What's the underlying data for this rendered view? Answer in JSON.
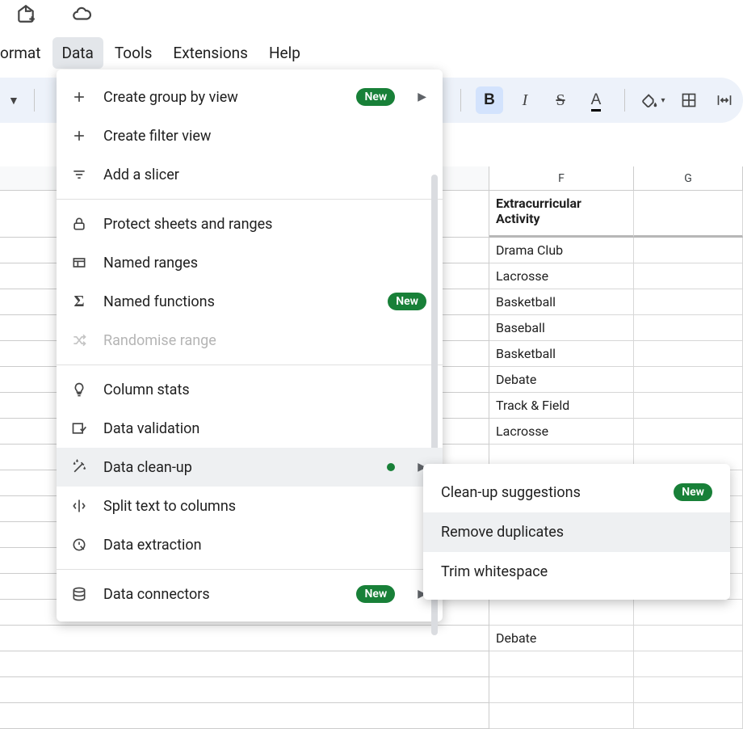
{
  "menubar": {
    "format": "ormat",
    "data": "Data",
    "tools": "Tools",
    "extensions": "Extensions",
    "help": "Help"
  },
  "toolbar": {
    "currency_symbol": "$",
    "bold": "B",
    "italic": "I",
    "strike": "S",
    "textcolor": "A",
    "fillarrow": "▾"
  },
  "columns": {
    "f": "F",
    "g": "G"
  },
  "headers": {
    "f": "Extracurricular Activity"
  },
  "rows_f": [
    "Drama Club",
    "Lacrosse",
    "Basketball",
    "Baseball",
    "Basketball",
    "Debate",
    "Track & Field",
    "Lacrosse",
    "",
    "",
    "",
    "",
    "",
    "",
    "",
    "Debate",
    "",
    "",
    ""
  ],
  "dropdown": {
    "create_group": "Create group by view",
    "create_filter": "Create filter view",
    "add_slicer": "Add a slicer",
    "protect": "Protect sheets and ranges",
    "named_ranges": "Named ranges",
    "named_functions": "Named functions",
    "randomise": "Randomise range",
    "column_stats": "Column stats",
    "data_validation": "Data validation",
    "data_cleanup": "Data clean-up",
    "split_text": "Split text to columns",
    "data_extraction": "Data extraction",
    "data_connectors": "Data connectors",
    "new_badge": "New"
  },
  "submenu": {
    "suggestions": "Clean-up suggestions",
    "remove_dup": "Remove duplicates",
    "trim": "Trim whitespace",
    "new_badge": "New"
  }
}
